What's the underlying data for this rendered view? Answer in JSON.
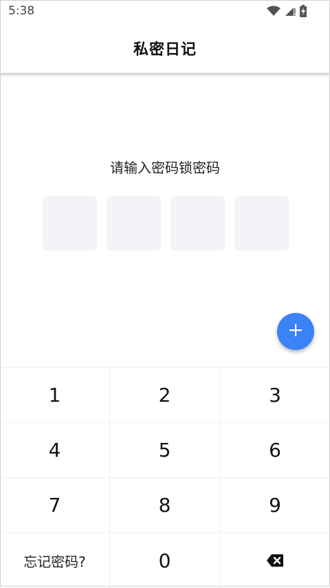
{
  "status_bar": {
    "time": "5:38",
    "icons": [
      "wifi-icon",
      "cellular-signal-icon",
      "battery-charging-icon"
    ]
  },
  "app_bar": {
    "title": "私密日记"
  },
  "lock": {
    "prompt": "请输入密码锁密码",
    "pin_boxes": [
      "",
      "",
      "",
      ""
    ]
  },
  "fab": {
    "icon": "plus-icon",
    "color": "#3b82f6"
  },
  "keypad": {
    "keys": [
      "1",
      "2",
      "3",
      "4",
      "5",
      "6",
      "7",
      "8",
      "9"
    ],
    "forgot_label": "忘记密码?",
    "zero": "0",
    "backspace_icon": "backspace-icon"
  }
}
